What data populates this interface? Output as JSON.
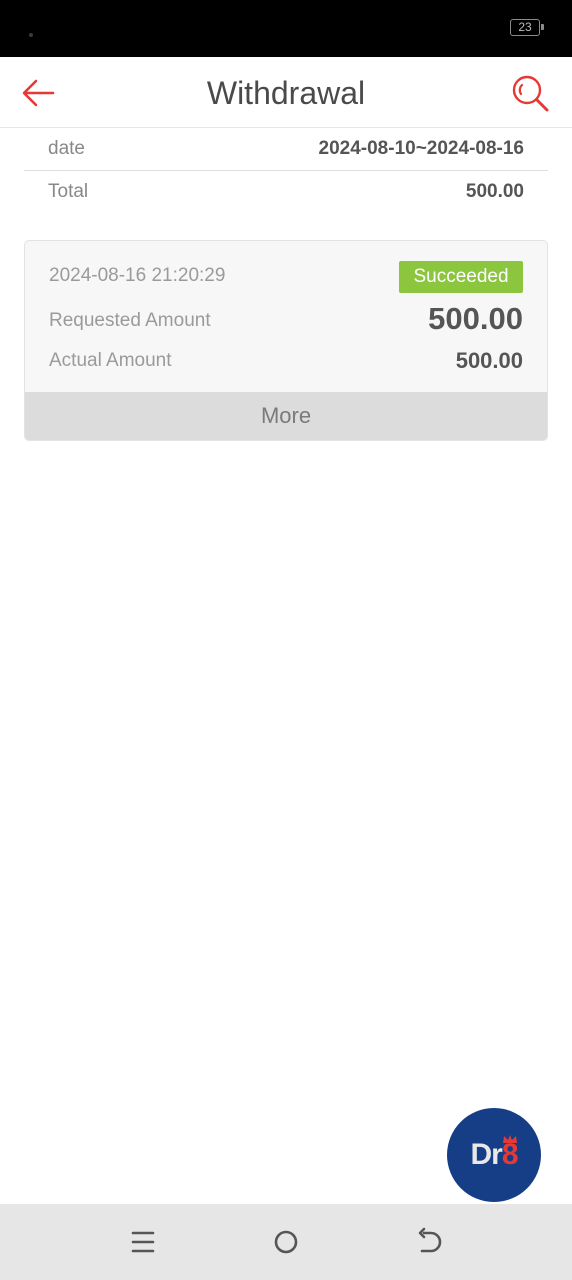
{
  "status_bar": {
    "battery": "23"
  },
  "header": {
    "title": "Withdrawal"
  },
  "summary": {
    "date_label": "date",
    "date_value": "2024-08-10~2024-08-16",
    "total_label": "Total",
    "total_value": "500.00"
  },
  "records": [
    {
      "timestamp": "2024-08-16 21:20:29",
      "status": "Succeeded",
      "requested_label": "Requested Amount",
      "requested_value": "500.00",
      "actual_label": "Actual Amount",
      "actual_value": "500.00",
      "more_label": "More"
    }
  ],
  "fab": {
    "text_main": "Dr",
    "text_accent": "8"
  },
  "colors": {
    "accent_red": "#e53935",
    "success_green": "#8cc63f",
    "fab_blue": "#163e86"
  },
  "icons": [
    "back-arrow-icon",
    "search-icon",
    "menu-icon",
    "home-icon",
    "back-nav-icon",
    "crown-icon"
  ]
}
